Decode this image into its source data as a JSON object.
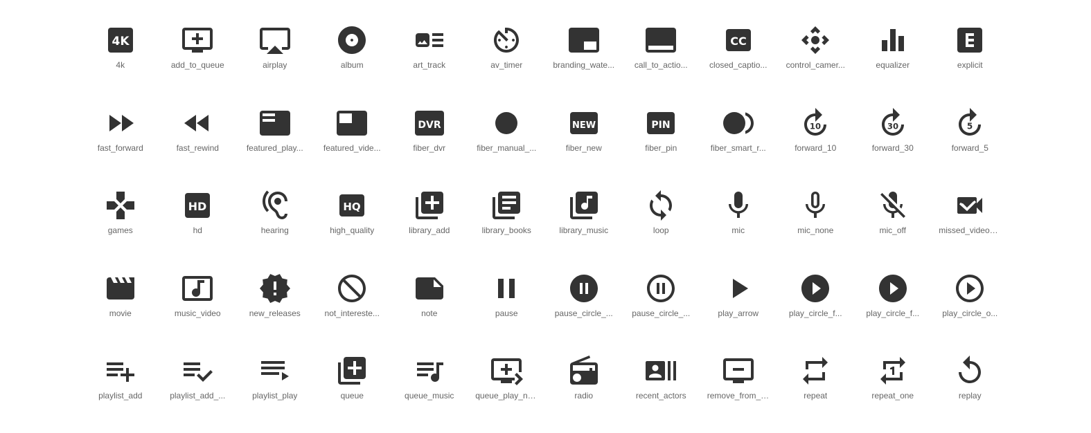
{
  "icon_color": "#333333",
  "label_color": "#666666",
  "icons": [
    {
      "label": "4k",
      "icon": "4k-icon"
    },
    {
      "label": "add_to_queue",
      "icon": "add-to-queue-icon"
    },
    {
      "label": "airplay",
      "icon": "airplay-icon"
    },
    {
      "label": "album",
      "icon": "album-icon"
    },
    {
      "label": "art_track",
      "icon": "art-track-icon"
    },
    {
      "label": "av_timer",
      "icon": "av-timer-icon"
    },
    {
      "label": "branding_wate...",
      "icon": "branding-watermark-icon"
    },
    {
      "label": "call_to_actio...",
      "icon": "call-to-action-icon"
    },
    {
      "label": "closed_captio...",
      "icon": "closed-caption-icon"
    },
    {
      "label": "control_camer...",
      "icon": "control-camera-icon"
    },
    {
      "label": "equalizer",
      "icon": "equalizer-icon"
    },
    {
      "label": "explicit",
      "icon": "explicit-icon"
    },
    {
      "label": "fast_forward",
      "icon": "fast-forward-icon"
    },
    {
      "label": "fast_rewind",
      "icon": "fast-rewind-icon"
    },
    {
      "label": "featured_play...",
      "icon": "featured-play-list-icon"
    },
    {
      "label": "featured_vide...",
      "icon": "featured-video-icon"
    },
    {
      "label": "fiber_dvr",
      "icon": "fiber-dvr-icon"
    },
    {
      "label": "fiber_manual_...",
      "icon": "fiber-manual-record-icon"
    },
    {
      "label": "fiber_new",
      "icon": "fiber-new-icon"
    },
    {
      "label": "fiber_pin",
      "icon": "fiber-pin-icon"
    },
    {
      "label": "fiber_smart_r...",
      "icon": "fiber-smart-record-icon"
    },
    {
      "label": "forward_10",
      "icon": "forward-10-icon"
    },
    {
      "label": "forward_30",
      "icon": "forward-30-icon"
    },
    {
      "label": "forward_5",
      "icon": "forward-5-icon"
    },
    {
      "label": "games",
      "icon": "games-icon"
    },
    {
      "label": "hd",
      "icon": "hd-icon"
    },
    {
      "label": "hearing",
      "icon": "hearing-icon"
    },
    {
      "label": "high_quality",
      "icon": "high-quality-icon"
    },
    {
      "label": "library_add",
      "icon": "library-add-icon"
    },
    {
      "label": "library_books",
      "icon": "library-books-icon"
    },
    {
      "label": "library_music",
      "icon": "library-music-icon"
    },
    {
      "label": "loop",
      "icon": "loop-icon"
    },
    {
      "label": "mic",
      "icon": "mic-icon"
    },
    {
      "label": "mic_none",
      "icon": "mic-none-icon"
    },
    {
      "label": "mic_off",
      "icon": "mic-off-icon"
    },
    {
      "label": "missed_video_...",
      "icon": "missed-video-call-icon"
    },
    {
      "label": "movie",
      "icon": "movie-icon"
    },
    {
      "label": "music_video",
      "icon": "music-video-icon"
    },
    {
      "label": "new_releases",
      "icon": "new-releases-icon"
    },
    {
      "label": "not_intereste...",
      "icon": "not-interested-icon"
    },
    {
      "label": "note",
      "icon": "note-icon"
    },
    {
      "label": "pause",
      "icon": "pause-icon"
    },
    {
      "label": "pause_circle_...",
      "icon": "pause-circle-filled-icon"
    },
    {
      "label": "pause_circle_...",
      "icon": "pause-circle-outline-icon"
    },
    {
      "label": "play_arrow",
      "icon": "play-arrow-icon"
    },
    {
      "label": "play_circle_f...",
      "icon": "play-circle-filled-icon"
    },
    {
      "label": "play_circle_f...",
      "icon": "play-circle-filled-white-icon"
    },
    {
      "label": "play_circle_o...",
      "icon": "play-circle-outline-icon"
    },
    {
      "label": "playlist_add",
      "icon": "playlist-add-icon"
    },
    {
      "label": "playlist_add_...",
      "icon": "playlist-add-check-icon"
    },
    {
      "label": "playlist_play",
      "icon": "playlist-play-icon"
    },
    {
      "label": "queue",
      "icon": "queue-icon"
    },
    {
      "label": "queue_music",
      "icon": "queue-music-icon"
    },
    {
      "label": "queue_play_ne...",
      "icon": "queue-play-next-icon"
    },
    {
      "label": "radio",
      "icon": "radio-icon"
    },
    {
      "label": "recent_actors",
      "icon": "recent-actors-icon"
    },
    {
      "label": "remove_from_q...",
      "icon": "remove-from-queue-icon"
    },
    {
      "label": "repeat",
      "icon": "repeat-icon"
    },
    {
      "label": "repeat_one",
      "icon": "repeat-one-icon"
    },
    {
      "label": "replay",
      "icon": "replay-icon"
    }
  ]
}
